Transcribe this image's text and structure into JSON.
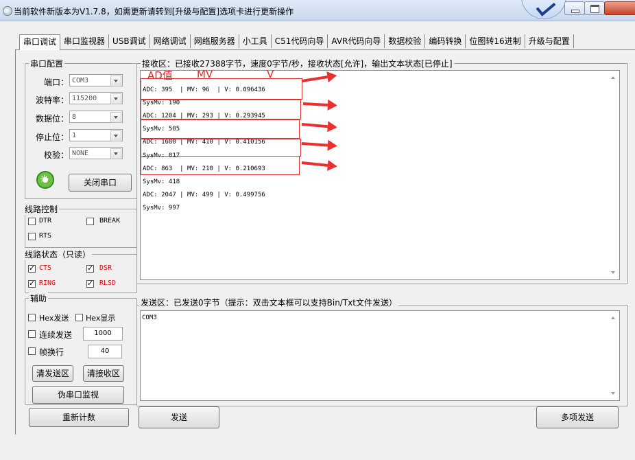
{
  "window": {
    "title": "当前软件新版本为V1.7.8，如需更新请转到[升级与配置]选项卡进行更新操作"
  },
  "tabs": [
    "串口调试",
    "串口监视器",
    "USB调试",
    "网络调试",
    "网络服务器",
    "小工具",
    "C51代码向导",
    "AVR代码向导",
    "数据校验",
    "编码转换",
    "位图转16进制",
    "升级与配置"
  ],
  "serial_config": {
    "group_label": "串口配置",
    "port_label": "端口：",
    "port_value": "COM3",
    "baud_label": "波特率：",
    "baud_value": "115200",
    "databits_label": "数据位：",
    "databits_value": "8",
    "stopbits_label": "停止位：",
    "stopbits_value": "1",
    "parity_label": "校验：",
    "parity_value": "NONE",
    "close_button": "关闭串口"
  },
  "line_control": {
    "group_label": "线路控制",
    "dtr": "DTR",
    "break": "BREAK",
    "rts": "RTS"
  },
  "line_status": {
    "group_label": "线路状态（只读）",
    "cts": "CTS",
    "dsr": "DSR",
    "ring": "RING",
    "rlsd": "RLSD",
    "status_color": "#e00000"
  },
  "assist": {
    "group_label": "辅助",
    "hex_send": "Hex发送",
    "hex_display": "Hex显示",
    "continuous_send": "连续发送",
    "continuous_interval": "1000",
    "frame_newline": "帧换行",
    "frame_value": "40",
    "clear_send": "清发送区",
    "clear_recv": "清接收区",
    "pseudo_monitor": "伪串口监视",
    "recount": "重新计数"
  },
  "receive": {
    "group_label": "接收区：已接收27388字节，速度0字节/秒，接收状态[允许]，输出文本状态[已停止]",
    "lines": [
      "ADC: 395  | MV: 96  | V: 0.096436",
      "SysMv: 190",
      "ADC: 1204 | MV: 293 | V: 0.293945",
      "SysMv: 585",
      "ADC: 1680 | MV: 410 | V: 0.410156",
      "SysMv: 817",
      "ADC: 863  | MV: 210 | V: 0.210693",
      "SysMv: 418",
      "ADC: 2047 | MV: 499 | V: 0.499756",
      "SysMv: 997"
    ],
    "annotations": {
      "ad": "AD值",
      "mv": "MV",
      "v": "V"
    },
    "annotation_color": "#ee2222"
  },
  "send": {
    "group_label": "发送区：已发送0字节（提示：双击文本框可以支持Bin/Txt文件发送）",
    "text": "COM3",
    "send_button": "发送",
    "multi_send_button": "多项发送"
  }
}
